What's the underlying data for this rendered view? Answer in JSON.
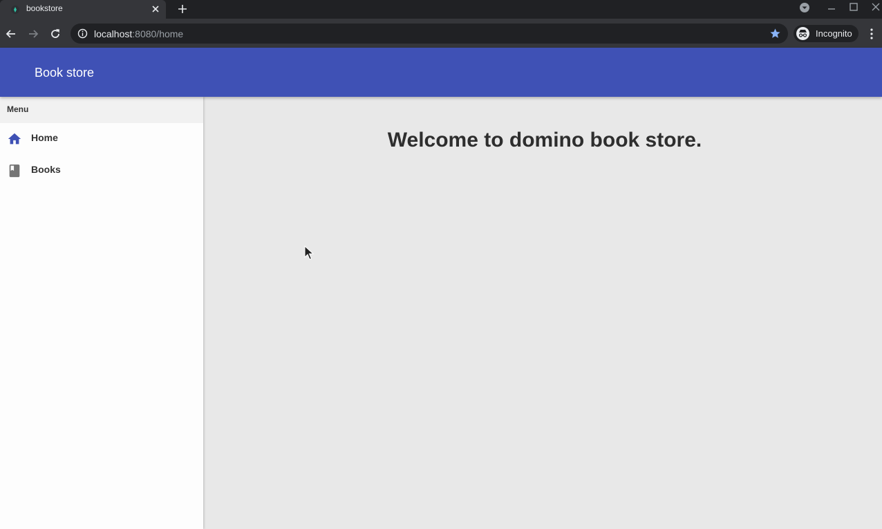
{
  "browser": {
    "tab": {
      "title": "bookstore"
    },
    "url": {
      "host": "localhost",
      "rest": ":8080/home"
    },
    "profile": {
      "label": "Incognito"
    }
  },
  "app": {
    "title": "Book store"
  },
  "sidebar": {
    "header": "Menu",
    "items": [
      {
        "label": "Home",
        "icon": "home-icon",
        "color": "#3f51b5"
      },
      {
        "label": "Books",
        "icon": "book-icon",
        "color": "#757575"
      }
    ]
  },
  "main": {
    "welcome": "Welcome to domino book store."
  },
  "colors": {
    "primary": "#3f51b5",
    "content_bg": "#e8e8e8",
    "sidebar_bg": "#fdfdfd"
  }
}
